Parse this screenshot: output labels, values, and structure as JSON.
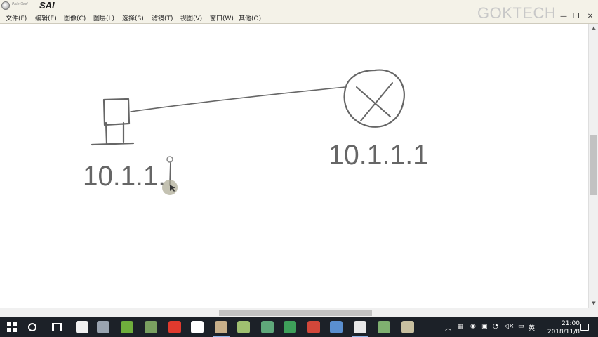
{
  "window": {
    "title": "SAI",
    "brand_small": "PaintTool",
    "watermark": "GOKTECH",
    "controls": {
      "minimize": "—",
      "restore": "❐",
      "close": "✕"
    }
  },
  "menu": [
    {
      "label": "文件(F)"
    },
    {
      "label": "编辑(E)"
    },
    {
      "label": "图像(C)"
    },
    {
      "label": "图层(L)"
    },
    {
      "label": "选择(S)"
    },
    {
      "label": "滤镜(T)"
    },
    {
      "label": "视图(V)"
    },
    {
      "label": "窗口(W)"
    },
    {
      "label": "其他(O)"
    }
  ],
  "canvas": {
    "left_label": "10.1.1.",
    "right_label": "10.1.1.1"
  },
  "taskbar": {
    "apps": [
      {
        "name": "app-icon-1",
        "color": "#f0f0f0"
      },
      {
        "name": "app-icon-2",
        "color": "#9aa4b0"
      },
      {
        "name": "app-icon-3",
        "color": "#6fae3c"
      },
      {
        "name": "app-icon-4",
        "color": "#7aa060"
      },
      {
        "name": "app-icon-5",
        "color": "#e03a2e"
      },
      {
        "name": "app-icon-6",
        "color": "#ffffff"
      },
      {
        "name": "app-icon-7",
        "color": "#c8b08a"
      },
      {
        "name": "app-icon-8",
        "color": "#a0c070"
      },
      {
        "name": "app-icon-9",
        "color": "#5fa87a"
      },
      {
        "name": "app-icon-10",
        "color": "#3ea05a"
      },
      {
        "name": "app-icon-11",
        "color": "#d2473a"
      },
      {
        "name": "app-icon-12",
        "color": "#5a8fd0"
      },
      {
        "name": "app-icon-13",
        "color": "#e8e8e8"
      },
      {
        "name": "app-icon-14",
        "color": "#7fb070"
      },
      {
        "name": "app-icon-15",
        "color": "#c8c0a0"
      }
    ],
    "ime": "英",
    "time": "21:00",
    "date": "2018/11/8"
  }
}
